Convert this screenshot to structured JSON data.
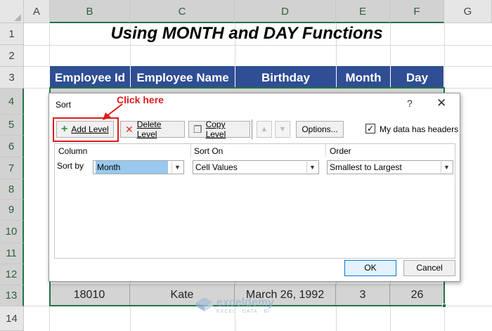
{
  "columns": [
    "A",
    "B",
    "C",
    "D",
    "E",
    "F",
    "G"
  ],
  "rows": [
    "1",
    "2",
    "3",
    "4",
    "5",
    "6",
    "7",
    "8",
    "9",
    "10",
    "11",
    "12",
    "13",
    "14"
  ],
  "title": "Using MONTH and DAY Functions",
  "table": {
    "headers": [
      "Employee Id",
      "Employee Name",
      "Birthday",
      "Month",
      "Day"
    ],
    "last_row": [
      "18010",
      "Kate",
      "March 26, 1992",
      "3",
      "26"
    ]
  },
  "dialog": {
    "title": "Sort",
    "help": "?",
    "close": "✕",
    "add_level": "Add Level",
    "delete_level": "Delete Level",
    "copy_level": "Copy Level",
    "options": "Options...",
    "my_data_has_headers": "My data has headers",
    "headers_checked": true,
    "col_header": "Column",
    "sorton_header": "Sort On",
    "order_header": "Order",
    "sort_by_label": "Sort by",
    "column_value": "Month",
    "sorton_value": "Cell Values",
    "order_value": "Smallest to Largest",
    "ok": "OK",
    "cancel": "Cancel"
  },
  "annotation": {
    "callout": "Click here",
    "color": "#e01b1b"
  },
  "watermark": {
    "name": "exceldemy",
    "sub": "EXCEL · DATA · BI"
  },
  "colors": {
    "header_fill": "#2f4e93",
    "excel_green": "#217346",
    "dialog_selected": "#99c9ef"
  }
}
